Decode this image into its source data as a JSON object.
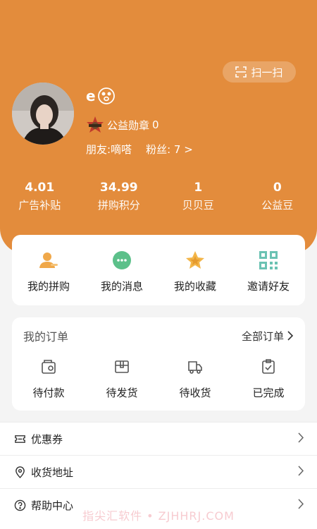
{
  "header": {
    "scan_label": "扫一扫",
    "nickname": "e",
    "badge_label": "公益勋章",
    "badge_count": "0",
    "friend_label": "朋友:嘀嗒",
    "fans_label": "粉丝: 7 >"
  },
  "stats": [
    {
      "value": "4.01",
      "label": "广告补贴"
    },
    {
      "value": "34.99",
      "label": "拼购积分"
    },
    {
      "value": "1",
      "label": "贝贝豆"
    },
    {
      "value": "0",
      "label": "公益豆"
    }
  ],
  "actions": [
    {
      "label": "我的拼购",
      "icon": "user-icon"
    },
    {
      "label": "我的消息",
      "icon": "message-icon"
    },
    {
      "label": "我的收藏",
      "icon": "star-icon"
    },
    {
      "label": "邀请好友",
      "icon": "qrcode-icon"
    }
  ],
  "orders": {
    "title": "我的订单",
    "all_label": "全部订单",
    "items": [
      {
        "label": "待付款",
        "icon": "wallet-icon"
      },
      {
        "label": "待发货",
        "icon": "box-icon"
      },
      {
        "label": "待收货",
        "icon": "truck-icon"
      },
      {
        "label": "已完成",
        "icon": "clipboard-check-icon"
      }
    ]
  },
  "menu": [
    {
      "label": "优惠券",
      "icon": "ticket-icon"
    },
    {
      "label": "收货地址",
      "icon": "location-icon"
    },
    {
      "label": "帮助中心",
      "icon": "help-icon"
    }
  ],
  "watermark": "指尖汇软件 • ZJHHRJ.COM",
  "colors": {
    "accent": "#e38c3c",
    "message": "#5cc08a",
    "qrcode": "#6bc2b3",
    "user": "#f0a84a"
  }
}
